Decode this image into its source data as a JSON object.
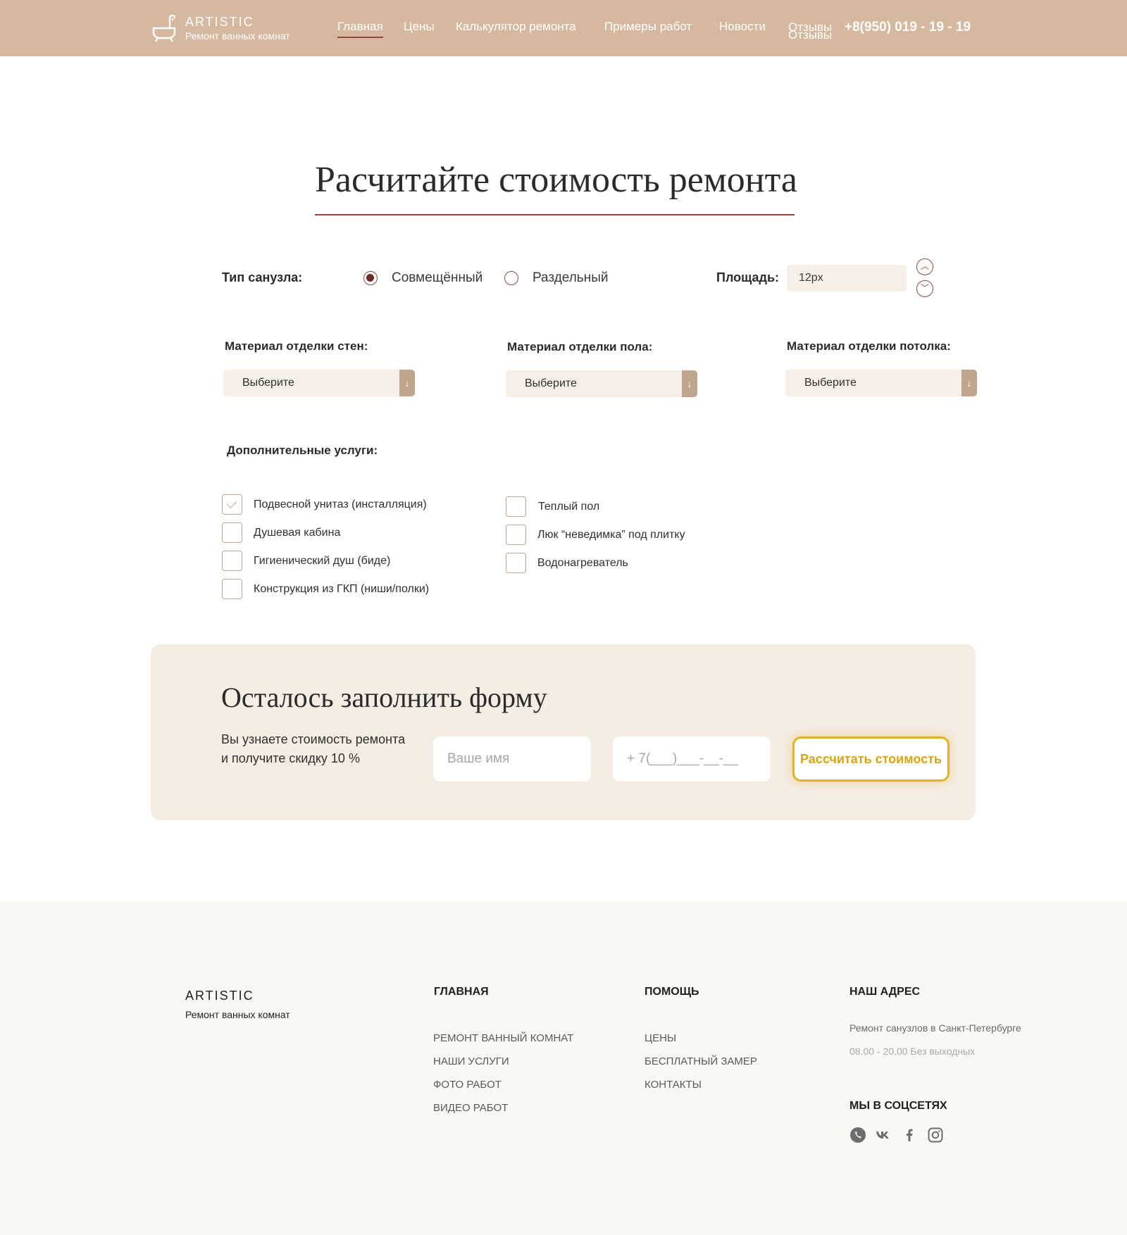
{
  "header": {
    "logo_title": "ARTISTIC",
    "logo_subtitle": "Ремонт ванных комнат",
    "nav": [
      "Главная",
      "Цены",
      "Калькулятор ремонта",
      "Примеры работ",
      "Новости",
      "Отзывы"
    ],
    "nav_active": "Главная",
    "phone": "+8(950) 019 - 19 - 19",
    "logo_icon": "bathtub-icon",
    "background_color": "#d5b89d"
  },
  "calculator": {
    "title": "Расчитайте стоимость ремонта",
    "bathroom_type_label": "Тип санузла:",
    "bathroom_types": [
      "Совмещённый",
      "Раздельный"
    ],
    "bathroom_type_selected": "Совмещённый",
    "area_label": "Площадь:",
    "area_value": "12px",
    "walls_label": "Материал отделки стен:",
    "floor_label": "Материал отделки пола:",
    "ceiling_label": "Материал отделки потолка:",
    "select_placeholder": "Выберите",
    "select_arrow": "↓",
    "extras_label": "Дополнительные услуги:",
    "extras_left": [
      {
        "label": "Подвесной унитаз (инсталляция)",
        "checked": true
      },
      {
        "label": "Душевая кабина",
        "checked": false
      },
      {
        "label": "Гигиенический душ (биде)",
        "checked": false
      },
      {
        "label": "Конструкция из ГКП (ниши/полки)",
        "checked": false
      }
    ],
    "extras_right": [
      {
        "label": "Теплый пол",
        "checked": false
      },
      {
        "label": "Люк “неведимка” под плитку",
        "checked": false
      },
      {
        "label": "Водонагреватель",
        "checked": false
      }
    ]
  },
  "lead_form": {
    "title": "Осталось заполнить форму",
    "description_line1": "Вы узнаете стоимость ремонта",
    "description_line2": "и получите скидку 10 %",
    "name_placeholder": "Ваше имя",
    "phone_placeholder": "+ 7(___)___-__-__",
    "submit_label": "Рассчитать стоимость",
    "accent_color": "#e2b421"
  },
  "footer": {
    "logo_title": "ARTISTIC",
    "logo_subtitle": "Ремонт ванных комнат",
    "col_main_title": "ГЛАВНАЯ",
    "col_main_links": [
      "РЕМОНТ ВАННЫЙ КОМНАТ",
      "НАШИ УСЛУГИ",
      "ФОТО РАБОТ",
      "ВИДЕО РАБОТ"
    ],
    "col_help_title": "ПОМОЩЬ",
    "col_help_links": [
      "ЦЕНЫ",
      "БЕСПЛАТНЫЙ ЗАМЕР",
      "КОНТАКТЫ"
    ],
    "address_title": "НАШ АДРЕС",
    "address_text": "Ремонт санузлов в Санкт-Петербурге",
    "hours_text": "08.00 - 20.00 Без выходных",
    "social_title": "МЫ В СОЦСЕТЯХ",
    "social_icons": [
      "whatsapp-icon",
      "vk-icon",
      "facebook-icon",
      "instagram-icon"
    ]
  }
}
